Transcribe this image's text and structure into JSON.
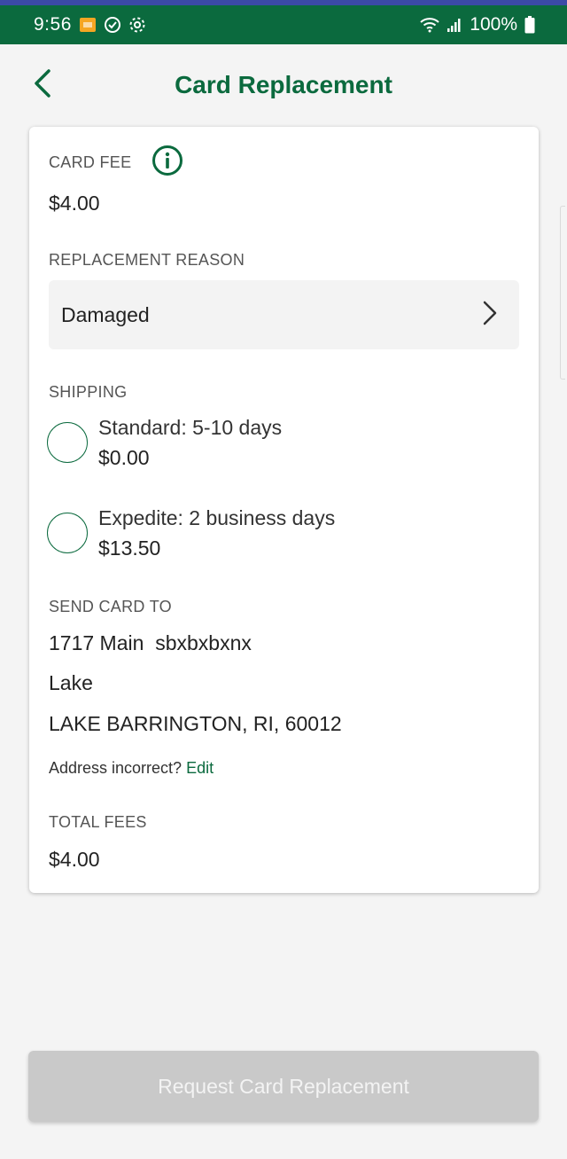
{
  "status_bar": {
    "time": "9:56",
    "battery": "100%",
    "icons": [
      "notification-app-icon",
      "sync-icon",
      "settings-icon",
      "wifi-icon",
      "signal-icon",
      "battery-icon"
    ]
  },
  "header": {
    "title": "Card Replacement",
    "back_icon": "chevron-left-icon"
  },
  "card_fee": {
    "label": "CARD FEE",
    "value": "$4.00",
    "info_icon": "info-icon"
  },
  "replacement_reason": {
    "label": "REPLACEMENT REASON",
    "selected": "Damaged",
    "chevron_icon": "chevron-right-icon"
  },
  "shipping": {
    "label": "SHIPPING",
    "options": [
      {
        "name": "Standard: 5-10 days",
        "price": "$0.00",
        "selected": false
      },
      {
        "name": "Expedite: 2 business days",
        "price": "$13.50",
        "selected": false
      }
    ]
  },
  "send_card_to": {
    "label": "SEND CARD TO",
    "lines": [
      "1717 Main  sbxbxbxnx",
      "Lake",
      "LAKE BARRINGTON, RI, 60012"
    ],
    "note_prefix": "Address incorrect?",
    "edit_label": "Edit"
  },
  "total_fees": {
    "label": "TOTAL FEES",
    "value": "$4.00"
  },
  "submit": {
    "label": "Request Card Replacement",
    "enabled": false
  },
  "colors": {
    "brand_green": "#0b6a3e",
    "top_stripe": "#3b4aa6",
    "disabled_button": "#c9c9c9"
  }
}
